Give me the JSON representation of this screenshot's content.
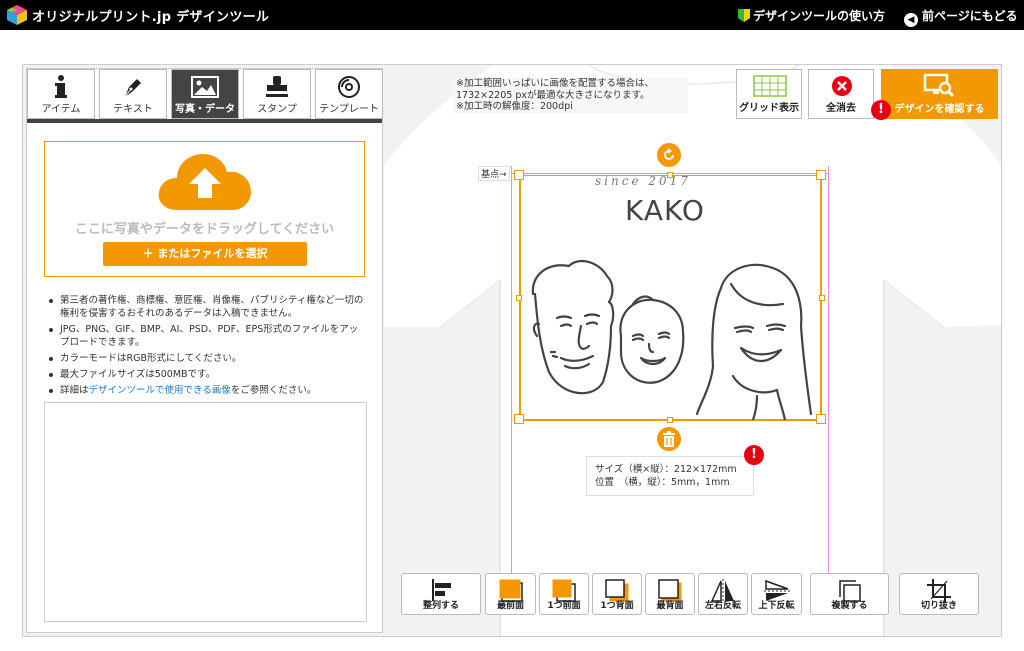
{
  "header": {
    "brand": "オリジナルプリント.jp  デザインツール",
    "help_link": "デザインツールの使い方",
    "back_link": "前ページにもどる"
  },
  "tabs": [
    {
      "label": "アイテム",
      "icon": "info-icon",
      "active": false
    },
    {
      "label": "テキスト",
      "icon": "pen-icon",
      "active": false
    },
    {
      "label": "写真・データ",
      "icon": "image-icon",
      "active": true
    },
    {
      "label": "スタンプ",
      "icon": "stamp-icon",
      "active": false
    },
    {
      "label": "テンプレート",
      "icon": "template-icon",
      "active": false
    }
  ],
  "upload": {
    "drop_text": "ここに写真やデータをドラッグしてください",
    "select_button": "＋ またはファイルを選択"
  },
  "notes": {
    "n1": "第三者の著作権、商標権、意匠権、肖像権、パブリシティ権など一切の権利を侵害するおそれのあるデータは入稿できません。",
    "n2": "JPG、PNG、GIF、BMP、AI、PSD、PDF、EPS形式のファイルをアップロードできます。",
    "n3": "カラーモードはRGB形式にしてください。",
    "n4": "最大ファイルサイズは500MBです。",
    "n5_prefix": "詳細は",
    "n5_link": "デザインツールで使用できる画像",
    "n5_suffix": "をご参照ください。"
  },
  "canvas_note": {
    "line1": "※加工範囲いっぱいに画像を配置する場合は、",
    "line2": "1732×2205 pxが最適な大きさになります。",
    "line3": "※加工時の解像度：200dpi"
  },
  "toolbar": {
    "grid": "グリッド表示",
    "clear": "全消去",
    "confirm": "デザインを確認する",
    "alert": "!"
  },
  "design": {
    "base_label": "基点→",
    "script": "since 2017",
    "title": "KAKO"
  },
  "size_info": {
    "size": "サイズ（横×縦）：212×172mm",
    "position": "位置　（横，縦）：5mm，1mm"
  },
  "bottom_tools": [
    {
      "label": "整列する"
    },
    {
      "label": "最前面"
    },
    {
      "label": "1つ前面"
    },
    {
      "label": "1つ背面"
    },
    {
      "label": "最背面"
    },
    {
      "label": "左右反転"
    },
    {
      "label": "上下反転"
    },
    {
      "label": "複製する"
    },
    {
      "label": "切り抜き"
    }
  ],
  "colors": {
    "accent": "#f39800",
    "alert": "#e60012",
    "guide": "#e88bd8",
    "link": "#1a7ac7"
  }
}
